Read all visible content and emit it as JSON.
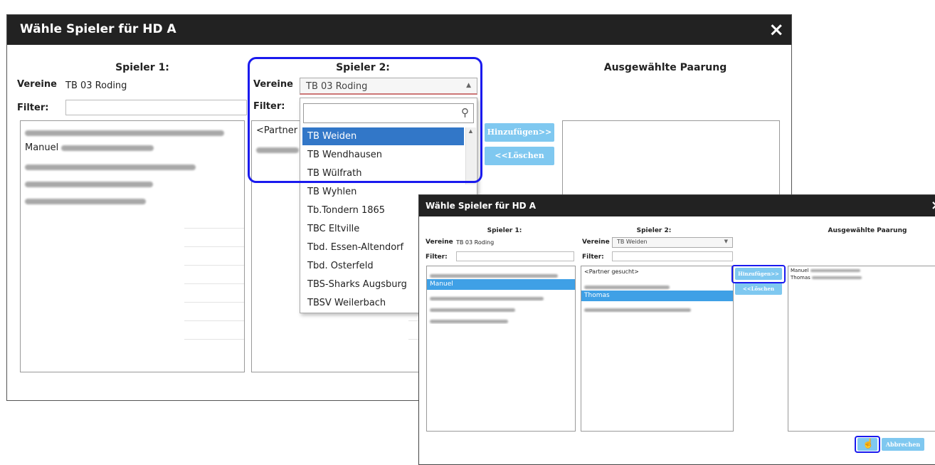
{
  "dialog": {
    "title": "Wähle Spieler für HD A",
    "close_glyph": "×",
    "player1_header": "Spieler 1:",
    "player2_header": "Spieler 2:",
    "pairing_header": "Ausgewählte Paarung",
    "club_label": "Vereine",
    "filter_label": "Filter:",
    "player1_club": "TB 03 Roding",
    "player2_club_select": "TB 03 Roding",
    "player1_list": [
      "",
      "Manuel",
      "",
      "",
      ""
    ],
    "player2_list_first": "<Partner g",
    "add_button": "Hinzufügen>>",
    "delete_button": "<<Löschen",
    "dropdown_options": [
      "TB Weiden",
      "TB Wendhausen",
      "TB Wülfrath",
      "TB Wyhlen",
      "Tb.Tondern 1865",
      "TBC Eltville",
      "Tbd. Essen-Altendorf",
      "Tbd. Osterfeld",
      "TBS-Sharks Augsburg",
      "TBSV Weilerbach"
    ],
    "dropdown_selected_index": 0
  },
  "dialog2": {
    "title": "Wähle Spieler für HD A",
    "close_glyph": "×",
    "player1_header": "Spieler 1:",
    "player2_header": "Spieler 2:",
    "pairing_header": "Ausgewählte Paarung",
    "club_label": "Vereine",
    "filter_label": "Filter:",
    "player1_club": "TB 03 Roding",
    "player2_club_select": "TB Weiden",
    "player1_list": [
      "",
      "Manuel",
      "",
      "",
      ""
    ],
    "player1_selected_index": 1,
    "player2_list": [
      "<Partner gesucht>",
      "",
      "Thomas",
      ""
    ],
    "player2_selected_index": 2,
    "pairing_list": [
      "Manuel",
      "Thomas"
    ],
    "add_button": "Hinzufügen>>",
    "delete_button": "<<Löschen",
    "ok_button": "",
    "cancel_button": "Abbrechen"
  },
  "colors": {
    "titlebar": "#222222",
    "button": "#7fc8f0",
    "highlight": "#3277c8",
    "callout": "#1a1aee"
  }
}
